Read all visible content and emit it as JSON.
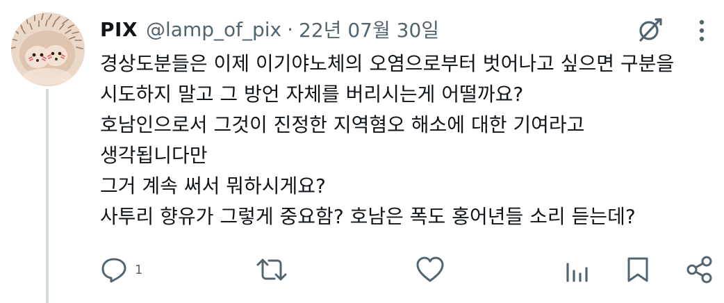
{
  "tweet": {
    "author": {
      "display_name": "PIX",
      "handle": "@lamp_of_pix",
      "separator": "·",
      "date": "22년 07월 30일",
      "avatar": "hedgehog-photo"
    },
    "body_lines": [
      "경상도분들은 이제 이기야노체의 오염으로부터 벗어나고 싶으면 구분을",
      "시도하지 말고 그 방언 자체를 버리시는게 어떨까요?",
      "호남인으로서 그것이 진정한 지역혐오 해소에 대한 기여라고",
      "생각됩니다만",
      "그거 계속 써서 뭐하시게요?",
      "사투리 향유가 그렇게 중요함? 호남은 폭도 홍어년들 소리 듣는데?"
    ],
    "top_icons": {
      "grok": "grok-icon",
      "more": "more-vertical-icon"
    },
    "actions": {
      "reply": {
        "icon": "reply-icon",
        "count": "1"
      },
      "retweet": {
        "icon": "retweet-icon",
        "count": ""
      },
      "like": {
        "icon": "heart-icon",
        "count": ""
      },
      "views": {
        "icon": "views-icon",
        "count": ""
      },
      "bookmark": {
        "icon": "bookmark-icon"
      },
      "share": {
        "icon": "share-icon"
      }
    },
    "colors": {
      "text": "#0f1419",
      "secondary": "#536471",
      "thread_line": "#cfd9de",
      "background": "#ffffff"
    }
  }
}
